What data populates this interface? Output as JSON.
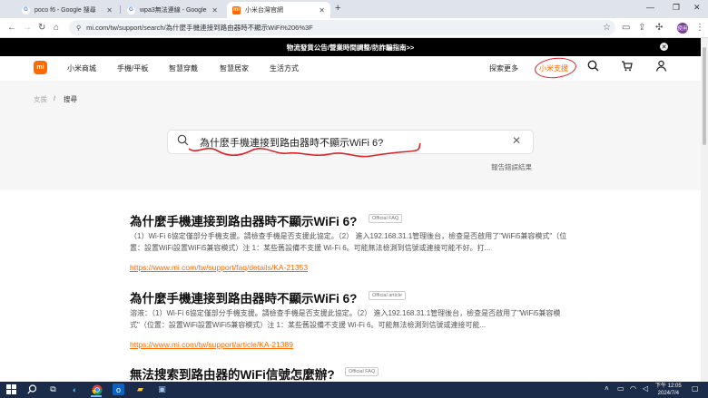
{
  "browser": {
    "tabs": [
      {
        "title": "poco f6 - Google 搜尋",
        "favicon": "G"
      },
      {
        "title": "wpa3無法連線 - Google 搜尋",
        "favicon": "G"
      },
      {
        "title": "小米台灣官網",
        "favicon": "mi"
      }
    ],
    "url": "mi.com/tw/support/search/為什麼手機連接到路由器時不顯示WiFi%206%3F",
    "profile_initials": "使用"
  },
  "announcement": "物流發貨公告/營業時間調整/防詐騙指南>>",
  "header": {
    "logo": "mi",
    "nav": [
      "小米商城",
      "手機/平板",
      "智慧穿戴",
      "智慧居家",
      "生活方式"
    ],
    "explore": "探索更多",
    "support": "小米支援"
  },
  "breadcrumb": {
    "root": "支援",
    "separator": "/",
    "current": "搜尋"
  },
  "search": {
    "query": "為什麼手機連接到路由器時不顯示WiFi 6?",
    "report_link": "報告錯誤結果"
  },
  "results": [
    {
      "title": "為什麼手機連接到路由器時不顯示WiFi 6?",
      "badge": "Official FAQ",
      "snippet": "（1）Wi-Fi 6協定僅部分手機支援。請檢查手機是否支援此協定。（2） 進入192.168.31.1管理後台，檢查是否啟用了\"WiFi5兼容模式\"（位置：設置WiFi設置WiFi5兼容模式）注 1：某些舊設備不支援 Wi-Fi 6。可能無法檢測到信號或連接可能不好。打...",
      "url": "https://www.mi.com/tw/support/faq/details/KA-21353"
    },
    {
      "title": "為什麼手機連接到路由器時不顯示WiFi 6?",
      "badge": "Official article",
      "snippet": "溶液：（1）Wi-Fi 6協定僅部分手機支援。請檢查手機是否支援此協定。（2） 進入192.168.31.1管理後台，檢查是否啟用了\"WiFi5兼容模式\"（位置：設置WiFi設置WiFi5兼容模式）注 1：某些舊設備不支援 Wi-Fi 6。可能無法檢測到信號或連接可能...",
      "url": "https://www.mi.com/tw/support/article/KA-21389"
    },
    {
      "title": "無法搜索到路由器的WiFi信號怎麼辦?",
      "badge": "Official FAQ"
    }
  ],
  "taskbar": {
    "time": "下午 12:05",
    "date": "2024/7/4"
  }
}
